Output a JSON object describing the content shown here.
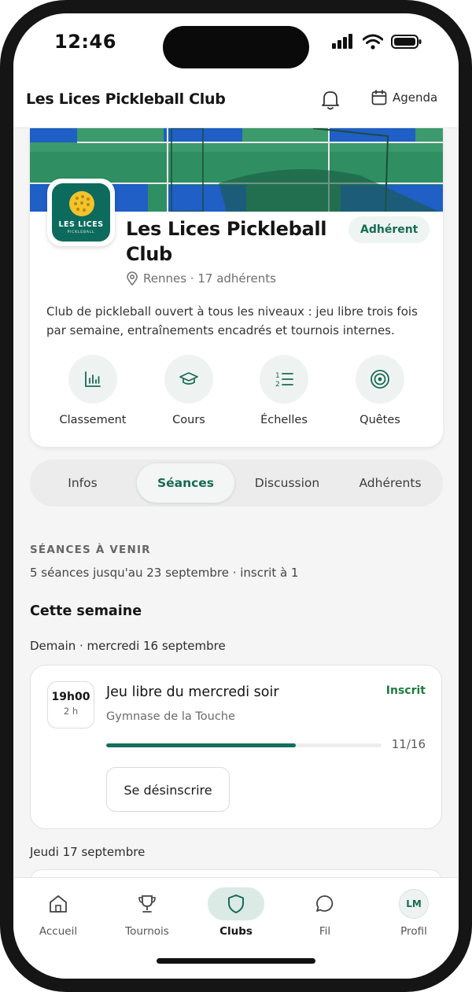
{
  "status_bar": {
    "time": "12:46"
  },
  "header": {
    "title": "Les Lices Pickleball Club",
    "agenda_label": "Agenda"
  },
  "club": {
    "logo_text": "LES LICES",
    "logo_subtext": "PICKLEBALL",
    "name": "Les Lices Pickleball Club",
    "badge": "Adhérent",
    "location": "Rennes · 17 adhérents",
    "description": "Club de pickleball ouvert à tous les niveaux : jeu libre trois fois par semaine, entraînements encadrés et tournois internes.",
    "actions": [
      {
        "label": "Classement",
        "icon": "chart-icon"
      },
      {
        "label": "Cours",
        "icon": "graduation-cap-icon"
      },
      {
        "label": "Échelles",
        "icon": "numbered-list-icon"
      },
      {
        "label": "Quêtes",
        "icon": "target-icon"
      }
    ]
  },
  "tabs": [
    {
      "label": "Infos",
      "active": false
    },
    {
      "label": "Séances",
      "active": true
    },
    {
      "label": "Discussion",
      "active": false
    },
    {
      "label": "Adhérents",
      "active": false
    }
  ],
  "sessions": {
    "section_label": "SÉANCES À VENIR",
    "summary": "5 séances jusqu'au 23 septembre · inscrit à 1",
    "week_heading": "Cette semaine",
    "groups": [
      {
        "day": "Demain · mercredi 16 septembre",
        "items": [
          {
            "time": "19h00",
            "duration": "2 h",
            "title": "Jeu libre du mercredi soir",
            "place": "Gymnase de la Touche",
            "status": "Inscrit",
            "count": "11/16",
            "fill_fraction": 0.6875,
            "button": "Se désinscrire"
          }
        ]
      },
      {
        "day": "Jeudi 17 septembre",
        "items": []
      }
    ]
  },
  "bottom_nav": [
    {
      "label": "Accueil",
      "icon": "home-icon",
      "active": false
    },
    {
      "label": "Tournois",
      "icon": "trophy-icon",
      "active": false
    },
    {
      "label": "Clubs",
      "icon": "shield-icon",
      "active": true
    },
    {
      "label": "Fil",
      "icon": "chat-bubble-icon",
      "active": false
    },
    {
      "label": "Profil",
      "icon": "avatar",
      "active": false,
      "initials": "LM"
    }
  ],
  "colors": {
    "accent": "#176b55",
    "status_green": "#1f7a40",
    "progress": "#126e5d"
  }
}
